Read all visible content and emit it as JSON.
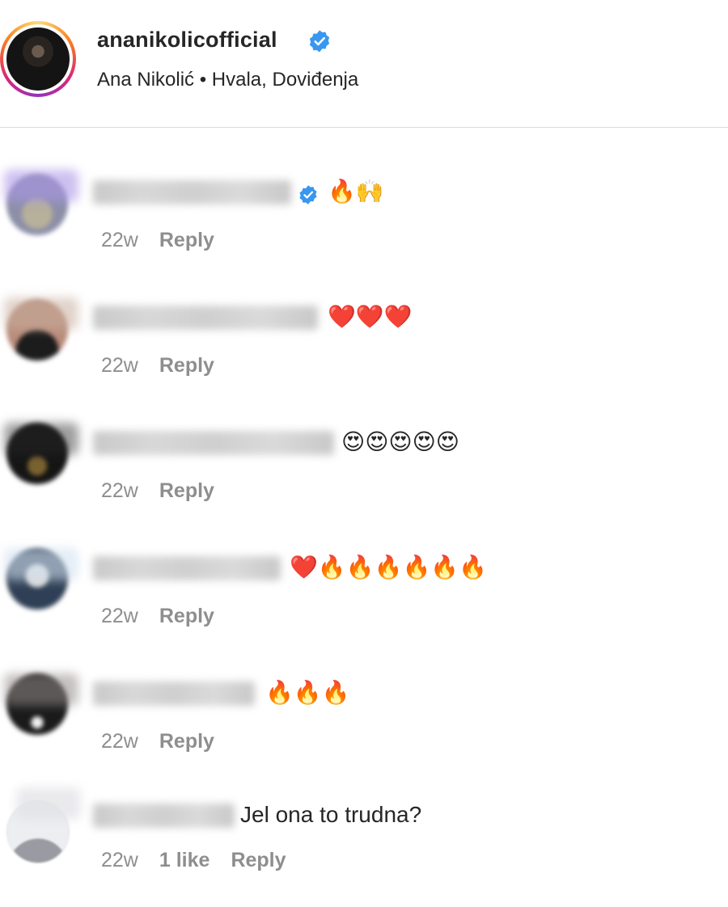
{
  "post": {
    "username": "ananikolicofficial",
    "subtitle": "Ana Nikolić • Hvala, Doviđenja",
    "verified": true
  },
  "colors": {
    "verified_blue": "#3897f0",
    "meta_grey": "#8e8e8e",
    "text": "#262626",
    "divider": "#dbdbdb"
  },
  "comments": [
    {
      "time": "22w",
      "reply_label": "Reply",
      "text": "🔥🙌",
      "verified": true
    },
    {
      "time": "22w",
      "reply_label": "Reply",
      "text": "❤️❤️❤️"
    },
    {
      "time": "22w",
      "reply_label": "Reply",
      "text": "😍😍😍😍😍"
    },
    {
      "time": "22w",
      "reply_label": "Reply",
      "text": "❤️🔥🔥🔥🔥🔥🔥"
    },
    {
      "time": "22w",
      "reply_label": "Reply",
      "text": "🔥🔥🔥"
    },
    {
      "time": "22w",
      "likes": "1 like",
      "reply_label": "Reply",
      "text": "Jel ona to trudna?"
    }
  ]
}
